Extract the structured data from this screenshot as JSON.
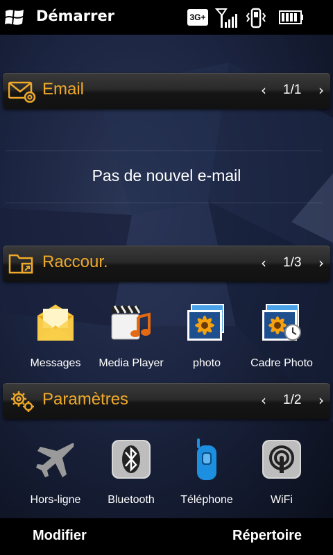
{
  "statusbar": {
    "title": "Démarrer",
    "network": "3G+",
    "icons": [
      "windows-start-icon",
      "network-3g-icon",
      "signal-strength-icon",
      "vibrate-mode-icon",
      "battery-icon"
    ]
  },
  "sections": {
    "email": {
      "title": "Email",
      "page": "1/1",
      "message": "Pas de nouvel e-mail",
      "icon": "email-icon"
    },
    "shortcuts": {
      "title": "Raccour.",
      "page": "1/3",
      "icon": "shortcut-folder-icon",
      "items": [
        {
          "label": "Messages",
          "icon": "messages-icon"
        },
        {
          "label": "Media Player",
          "icon": "media-player-icon"
        },
        {
          "label": "photo",
          "icon": "photo-icon"
        },
        {
          "label": "Cadre Photo",
          "icon": "photo-frame-icon"
        }
      ]
    },
    "settings": {
      "title": "Paramètres",
      "page": "1/2",
      "icon": "settings-gear-icon",
      "items": [
        {
          "label": "Hors-ligne",
          "icon": "airplane-icon"
        },
        {
          "label": "Bluetooth",
          "icon": "bluetooth-icon"
        },
        {
          "label": "Téléphone",
          "icon": "phone-icon"
        },
        {
          "label": "WiFi",
          "icon": "wifi-icon"
        }
      ]
    }
  },
  "softkeys": {
    "left": "Modifier",
    "right": "Répertoire"
  },
  "colors": {
    "accent": "#f0a929",
    "background": "#1b2440"
  }
}
